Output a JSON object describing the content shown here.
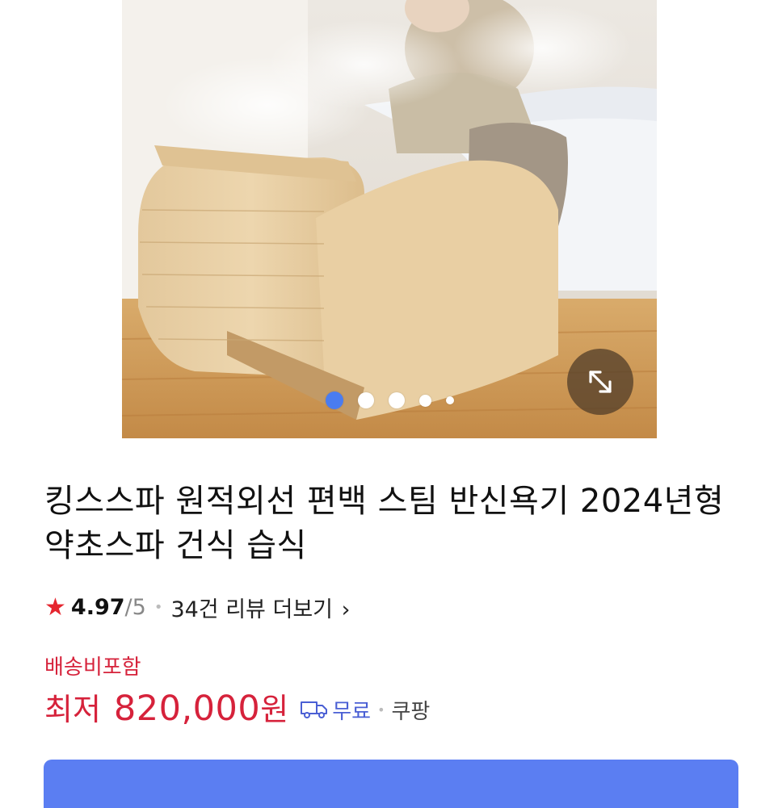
{
  "product": {
    "title": "킹스스파 원적외선 편백 스팀 반신욕기 2024년형 약초스파 건식 습식",
    "rating": {
      "score": "4.97",
      "max": "/5",
      "review_link": "34건 리뷰 더보기"
    },
    "shipping_label": "배송비포함",
    "price": {
      "prefix": "최저",
      "value": "820,000",
      "unit": "원"
    },
    "delivery": {
      "label": "무료",
      "seller": "쿠팡"
    }
  },
  "gallery": {
    "image_count": 5,
    "active_index": 0
  },
  "colors": {
    "accent_red": "#d6223b",
    "star": "#e5262f",
    "active_dot": "#4a7cf0",
    "delivery_blue": "#4a5fd4",
    "cta_blue": "#5b7ef2"
  }
}
